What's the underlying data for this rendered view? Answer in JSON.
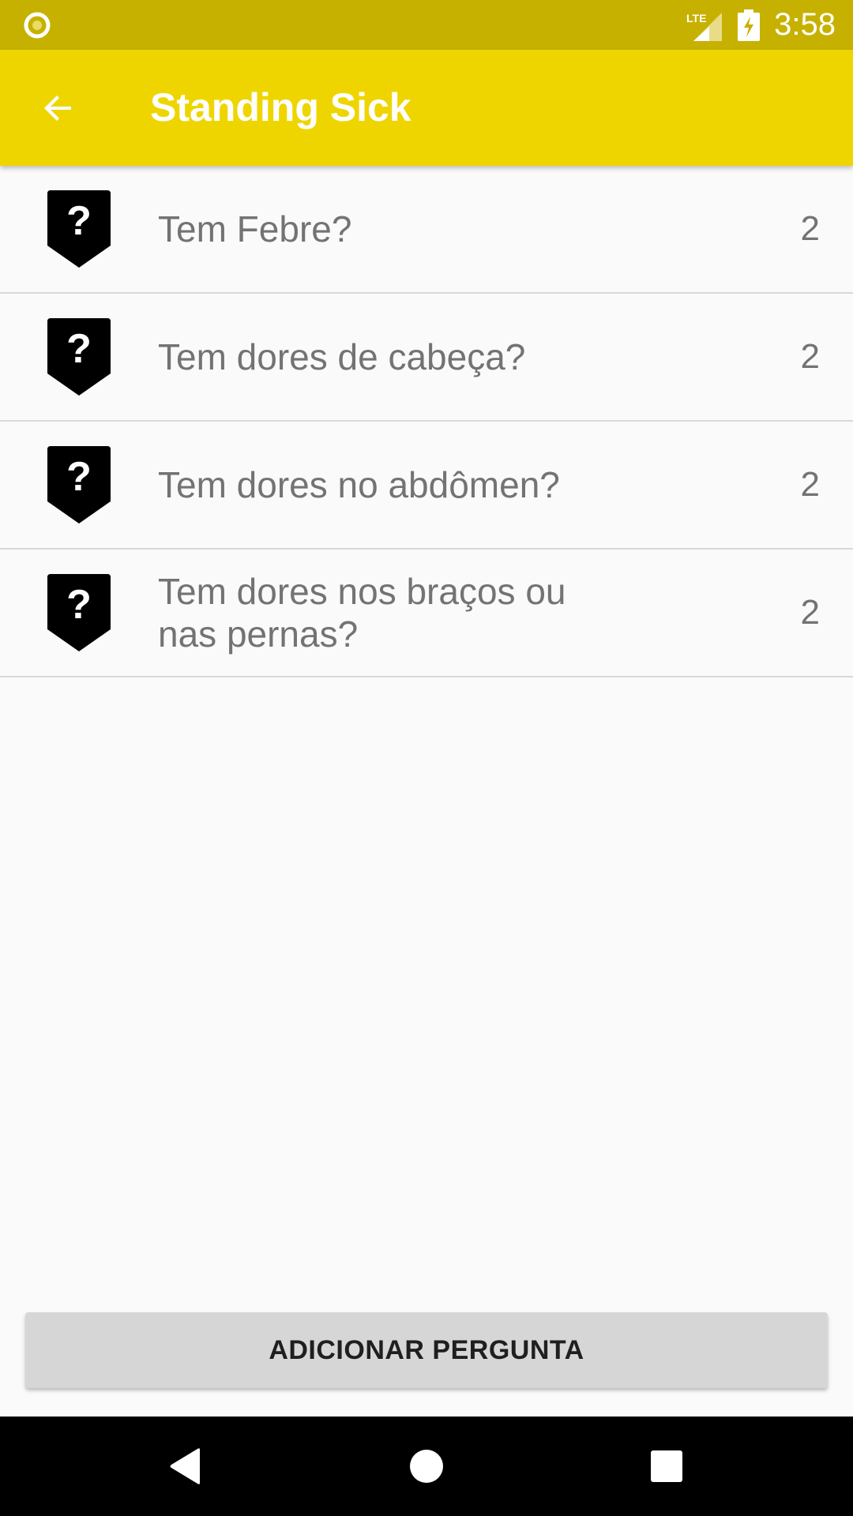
{
  "status_bar": {
    "time": "3:58",
    "network_label": "LTE",
    "icons": [
      "notification-circle-icon",
      "lte-signal-icon",
      "battery-charging-icon"
    ]
  },
  "app_bar": {
    "title": "Standing Sick",
    "back_icon": "arrow-left-icon"
  },
  "questions": [
    {
      "text": "Tem Febre?",
      "count": "2",
      "icon": "question-badge-icon"
    },
    {
      "text": "Tem dores de cabeça?",
      "count": "2",
      "icon": "question-badge-icon"
    },
    {
      "text": "Tem dores no abdômen?",
      "count": "2",
      "icon": "question-badge-icon"
    },
    {
      "text": "Tem dores nos braços ou nas pernas?",
      "count": "2",
      "icon": "question-badge-icon"
    }
  ],
  "add_button": {
    "label": "ADICIONAR PERGUNTA"
  },
  "nav_bar": {
    "icons": [
      "back-triangle-icon",
      "home-circle-icon",
      "recents-square-icon"
    ]
  },
  "colors": {
    "status_bar": "#c7b100",
    "app_bar": "#efd500",
    "background": "#fafafa",
    "text_secondary": "#737373",
    "button_bg": "#d6d6d6",
    "nav_bar": "#000000"
  }
}
